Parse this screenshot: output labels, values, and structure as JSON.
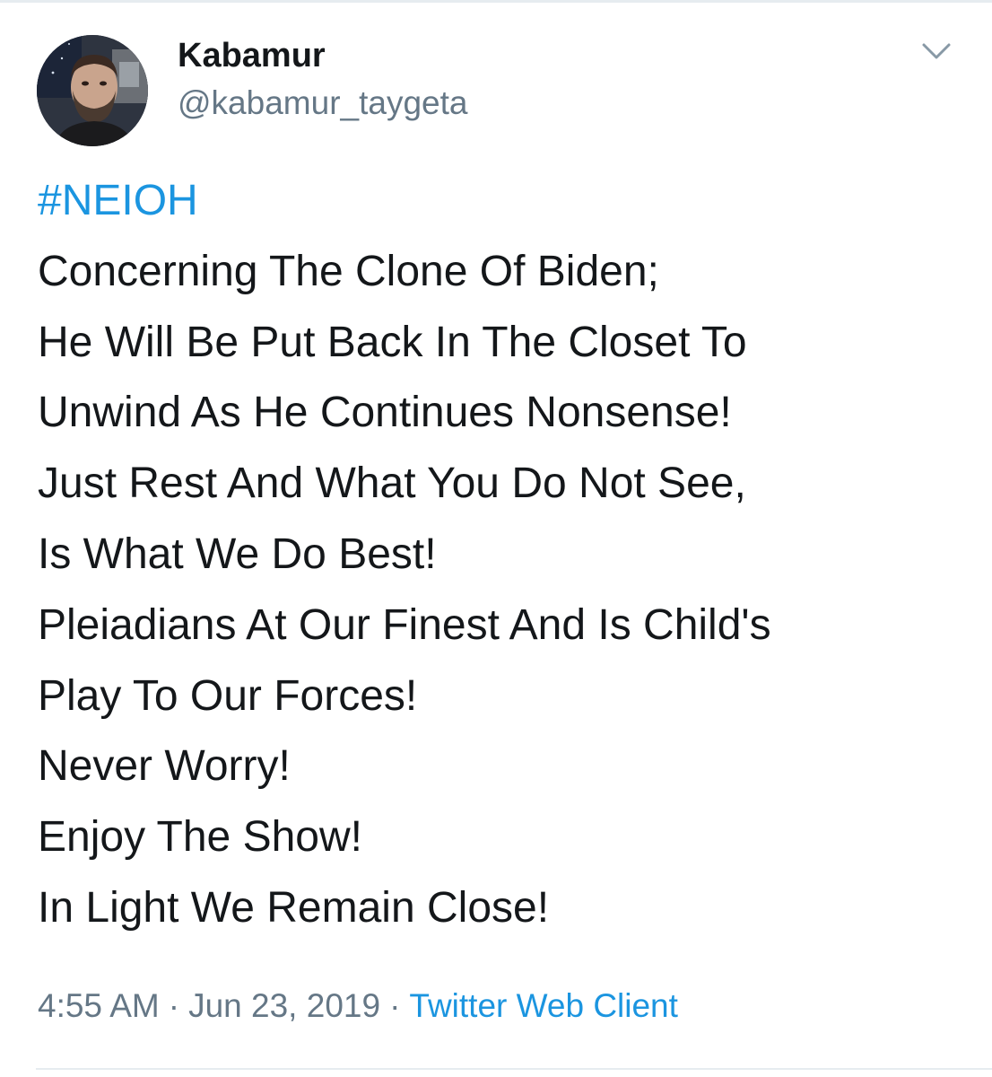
{
  "author": {
    "display_name": "Kabamur",
    "handle": "@kabamur_taygeta"
  },
  "tweet": {
    "hashtag": "#NEIOH",
    "lines": [
      "Concerning The Clone Of Biden;",
      "He Will Be Put Back In The Closet To",
      "Unwind As He Continues Nonsense!",
      "Just Rest And What You Do Not See,",
      "Is What We Do Best!",
      "Pleiadians At Our Finest And Is Child's",
      "Play To Our Forces!",
      "Never Worry!",
      "Enjoy The Show!",
      "In Light We Remain Close!"
    ]
  },
  "meta": {
    "time": "4:55 AM",
    "separator": "·",
    "date": "Jun 23, 2019",
    "source": "Twitter Web Client"
  },
  "icons": {
    "menu": "chevron-down-icon"
  },
  "colors": {
    "link": "#1b95e0",
    "secondary_text": "#657786",
    "primary_text": "#14171a",
    "divider": "#e6ecf0"
  }
}
